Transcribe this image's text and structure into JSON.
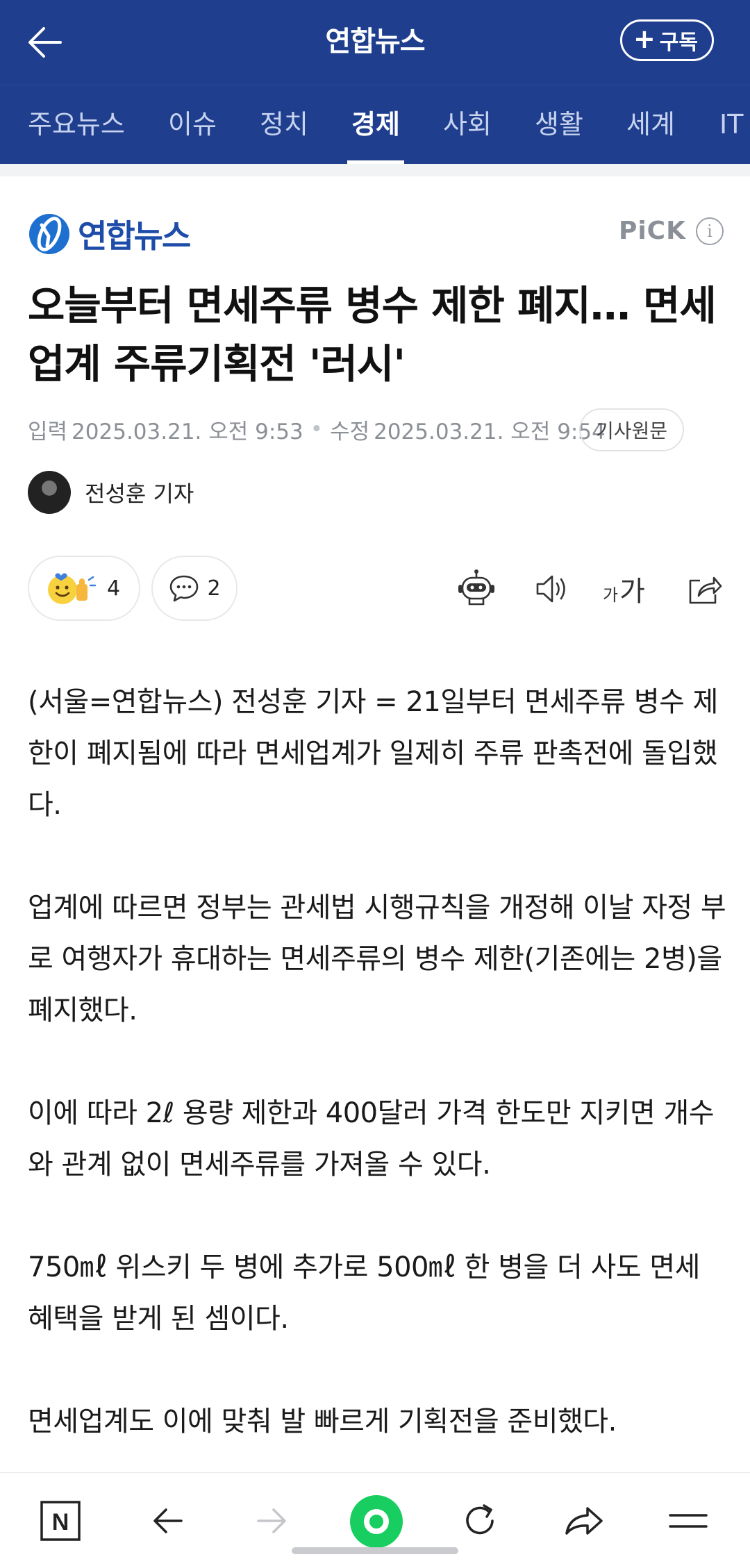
{
  "header": {
    "title": "연합뉴스",
    "subscribe_label": "구독",
    "subscribe_plus": "+"
  },
  "nav": {
    "tabs": [
      {
        "label": "주요뉴스"
      },
      {
        "label": "이슈"
      },
      {
        "label": "정치"
      },
      {
        "label": "경제"
      },
      {
        "label": "사회"
      },
      {
        "label": "생활"
      },
      {
        "label": "세계"
      },
      {
        "label": "IT"
      }
    ],
    "active_tab": "경제"
  },
  "publisher": {
    "name": "연합뉴스",
    "pick_label": "PiCK",
    "info_glyph": "i"
  },
  "article": {
    "headline": "오늘부터 면세주류 병수 제한 폐지… 면세업계 주류기획전 '러시'",
    "input_label": "입력",
    "input_date": "2025.03.21. 오전 9:53",
    "modified_label": "수정",
    "modified_date": "2025.03.21. 오전 9:54",
    "original_button": "기사원문",
    "reporter": "전성훈 기자",
    "reaction_count": "4",
    "comment_count": "2",
    "font_small": "가",
    "font_large": "가",
    "paragraphs": [
      "(서울=연합뉴스) 전성훈 기자 = 21일부터 면세주류 병수 제한이 폐지됨에 따라 면세업계가 일제히 주류 판촉전에 돌입했다.",
      "업계에 따르면 정부는 관세법 시행규칙을 개정해 이날 자정 부로 여행자가 휴대하는 면세주류의 병수 제한(기존에는 2병)을 폐지했다.",
      "이에 따라 2ℓ 용량 제한과 400달러 가격 한도만 지키면 개수와 관계 없이 면세주류를 가져올 수 있다.",
      "750㎖ 위스키 두 병에 추가로 500㎖ 한 병을 더 사도 면세 혜택을 받게 된 셈이다.",
      "면세업계도 이에 맞춰 발 빠르게 기획전을 준비했다."
    ]
  },
  "bottom_bar": {
    "naver_glyph": "N"
  },
  "colors": {
    "header_bg": "#1f3f8e",
    "brand_blue": "#1d4da8",
    "green_button": "#19ce60"
  }
}
